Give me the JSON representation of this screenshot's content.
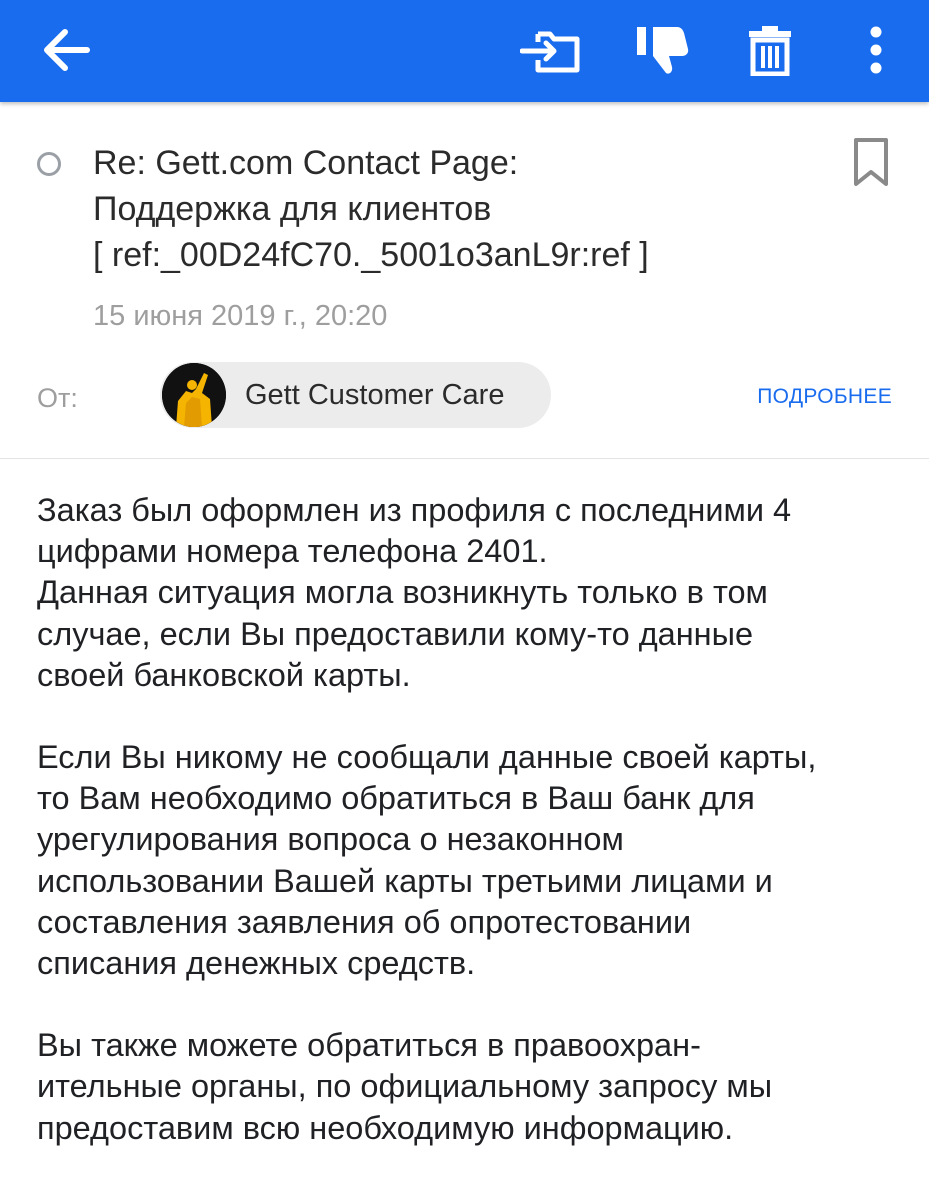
{
  "toolbar": {
    "color": "#1a6cef",
    "icons": [
      "arrow-back-icon",
      "move-to-folder-icon",
      "thumbs-down-icon",
      "trash-icon",
      "more-vert-icon"
    ]
  },
  "message": {
    "subject": "Re: Gett.com Contact Page:\nПоддержка для клиентов\n[ ref:_00D24fC70._5001o3anL9r:ref ]",
    "date": "15 июня 2019 г., 20:20",
    "from_label": "От:",
    "sender_name": "Gett Customer Care",
    "details_label": "ПОДРОБНЕЕ"
  },
  "body": {
    "paragraphs": [
      "Заказ был оформлен из профиля с последними 4\nцифрами номера телефона 2401.\nДанная ситуация могла возникнуть только в том\nслучае, если Вы предоставили кому-то данные\nсвоей банковской карты.",
      "Если Вы никому не сообщали данные своей карты,\nто Вам необходимо обратиться в Ваш банк для\nурегулирования вопроса о незаконном\nиспользовании Вашей карты третьими лицами и\nсоставления заявления об опротестовании\nсписания денежных средств.",
      "Вы также можете обратиться в правоохран-\nительные органы, по официальному запросу мы\nпредоставим всю необходимую информацию."
    ]
  }
}
